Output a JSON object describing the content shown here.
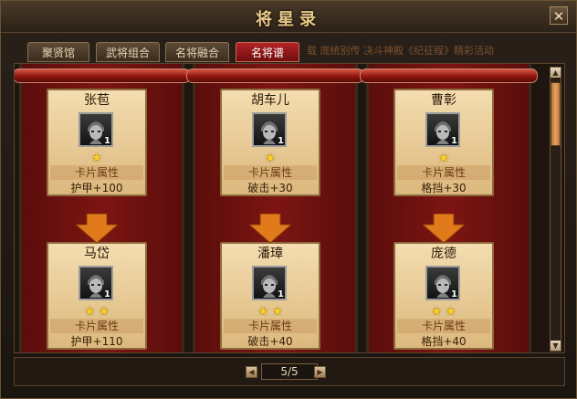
{
  "window": {
    "title": "将星录",
    "close_label": "✕"
  },
  "tabs": [
    {
      "label": "聚贤馆",
      "active": false
    },
    {
      "label": "武将组合",
      "active": false
    },
    {
      "label": "名将融合",
      "active": false
    },
    {
      "label": "名将谱",
      "active": true
    }
  ],
  "marquee": "载  庞统别传  决斗神殿《纪征程》精彩活动",
  "columns": [
    {
      "cards": [
        {
          "name": "张苞",
          "level": "1",
          "stars": 1,
          "attr_title": "卡片属性",
          "attr_value": "护甲+100"
        },
        {
          "name": "马岱",
          "level": "1",
          "stars": 2,
          "attr_title": "卡片属性",
          "attr_value": "护甲+110"
        }
      ]
    },
    {
      "cards": [
        {
          "name": "胡车儿",
          "level": "1",
          "stars": 1,
          "attr_title": "卡片属性",
          "attr_value": "破击+30"
        },
        {
          "name": "潘璋",
          "level": "1",
          "stars": 2,
          "attr_title": "卡片属性",
          "attr_value": "破击+40"
        }
      ]
    },
    {
      "cards": [
        {
          "name": "曹彰",
          "level": "1",
          "stars": 1,
          "attr_title": "卡片属性",
          "attr_value": "格挡+30"
        },
        {
          "name": "庞德",
          "level": "1",
          "stars": 2,
          "attr_title": "卡片属性",
          "attr_value": "格挡+40"
        }
      ]
    }
  ],
  "pagination": {
    "current": "5/5"
  },
  "icons": {
    "close": "close-icon",
    "prev": "triangle-left-icon",
    "next": "triangle-right-icon",
    "scroll_up": "arrow-up-icon",
    "scroll_down": "arrow-down-icon",
    "star": "star-icon"
  },
  "colors": {
    "accent_red": "#8d150f",
    "card_bg": "#f4ddb0",
    "star": "#ffd21f",
    "arrow": "#e07a1b"
  }
}
